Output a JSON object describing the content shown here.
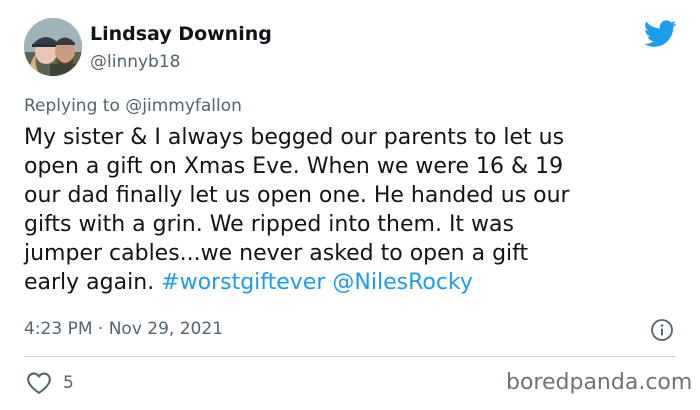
{
  "user": {
    "display_name": "Lindsay Downing",
    "handle": "@linnyb18"
  },
  "reply": {
    "prefix": "Replying to",
    "mention": "@jimmyfallon"
  },
  "tweet": {
    "lines": [
      "My sister & I always begged our parents to let us",
      "open a gift on Xmas Eve. When we were 16 & 19",
      "our dad finally let us open one. He handed us our",
      "gifts with a grin. We ripped into them. It was",
      "jumper cables...we never asked to open a gift"
    ],
    "last_line_text": "early again.",
    "hashtag": "#worstgiftever",
    "mention": "@NilesRocky",
    "time": "4:23 PM",
    "separator": "·",
    "date": "Nov 29, 2021"
  },
  "engagement": {
    "likes": "5"
  },
  "watermark": "boredpanda.com",
  "icons": {
    "brand": "twitter-bird-icon",
    "info": "info-icon",
    "like": "heart-icon"
  },
  "colors": {
    "link": "#1d9bf0",
    "muted": "#536471",
    "text": "#0f1419",
    "twitter_blue": "#1d9bf0"
  }
}
